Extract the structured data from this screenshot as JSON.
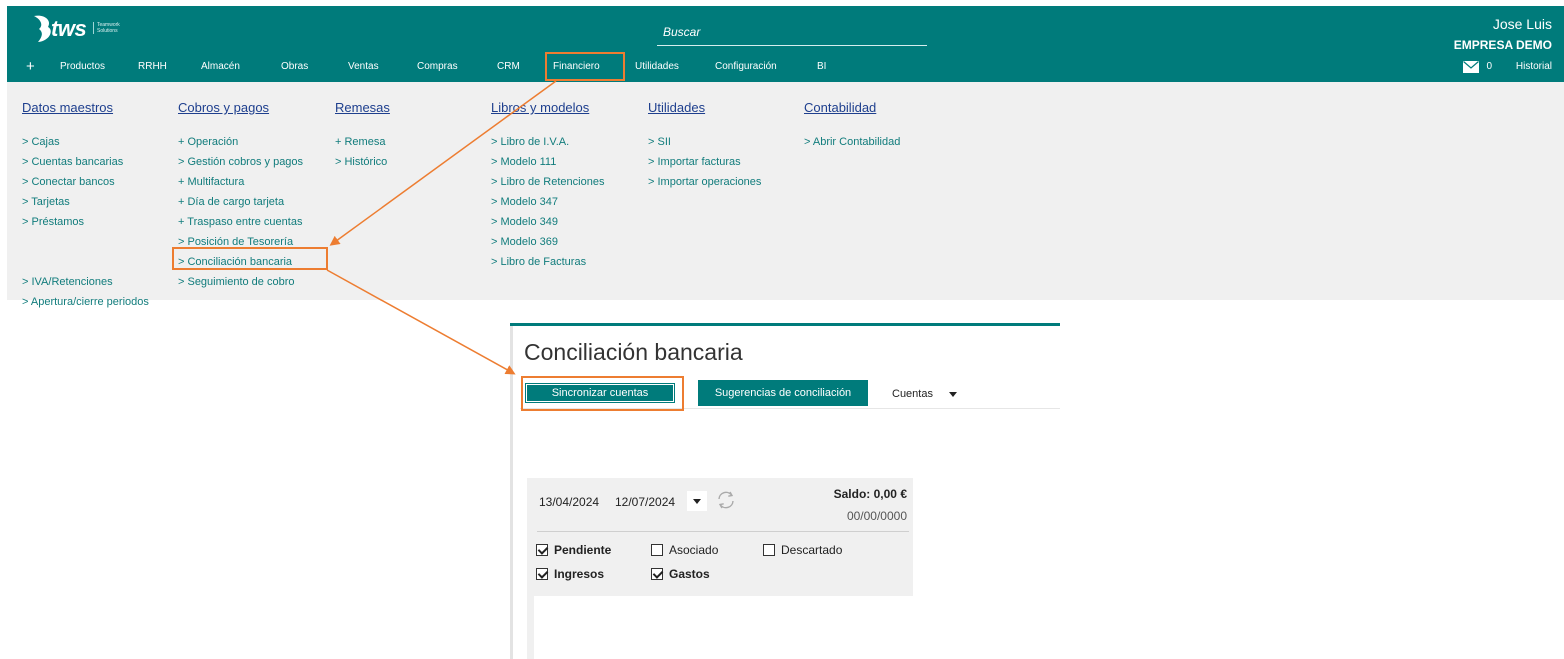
{
  "header": {
    "logo_text": "tws",
    "logo_tagline": "Teamwork Solutions",
    "search_placeholder": "Buscar",
    "user_name": "Jose Luis",
    "company": "EMPRESA DEMO",
    "mail_count": "0",
    "historial": "Historial"
  },
  "nav": {
    "plus": "+",
    "items": [
      "Productos",
      "RRHH",
      "Almacén",
      "Obras",
      "Ventas",
      "Compras",
      "CRM",
      "Financiero",
      "Utilidades",
      "Configuración",
      "BI"
    ]
  },
  "menu": {
    "datos_maestros": {
      "heading": "Datos maestros",
      "items": [
        "> Cajas",
        "> Cuentas bancarias",
        "> Conectar bancos",
        "> Tarjetas",
        "> Préstamos"
      ],
      "items2": [
        "> IVA/Retenciones",
        "> Apertura/cierre periodos"
      ]
    },
    "cobros_pagos": {
      "heading": "Cobros y pagos",
      "items": [
        "+ Operación",
        "> Gestión cobros y pagos",
        "+ Multifactura",
        "+ Día de cargo tarjeta",
        "+ Traspaso entre cuentas",
        "> Posición de Tesorería",
        "> Conciliación bancaria",
        "> Seguimiento de cobro"
      ]
    },
    "remesas": {
      "heading": "Remesas",
      "items": [
        "+ Remesa",
        "> Histórico"
      ]
    },
    "libros_modelos": {
      "heading": "Libros y modelos",
      "items": [
        "> Libro de I.V.A.",
        "> Modelo 111",
        "> Libro de Retenciones",
        "> Modelo 347",
        "> Modelo 349",
        "> Modelo 369",
        "> Libro de Facturas"
      ]
    },
    "utilidades": {
      "heading": "Utilidades",
      "items": [
        "> SII",
        "> Importar facturas",
        "> Importar operaciones"
      ]
    },
    "contabilidad": {
      "heading": "Contabilidad",
      "items": [
        "> Abrir Contabilidad"
      ]
    }
  },
  "detail": {
    "title": "Conciliación bancaria",
    "sync_button": "Sincronizar cuentas",
    "suggestions_button": "Sugerencias de conciliación",
    "cuentas": "Cuentas",
    "date_from": "13/04/2024",
    "date_to": "12/07/2024",
    "saldo": "Saldo: 0,00 €",
    "saldo_date": "00/00/0000",
    "filters": {
      "pendiente": "Pendiente",
      "asociado": "Asociado",
      "descartado": "Descartado",
      "ingresos": "Ingresos",
      "gastos": "Gastos"
    }
  },
  "colors": {
    "brand": "#007b7b",
    "highlight": "#ed7d31",
    "menu_link": "#117c7c",
    "menu_heading": "#1e3f8e"
  }
}
